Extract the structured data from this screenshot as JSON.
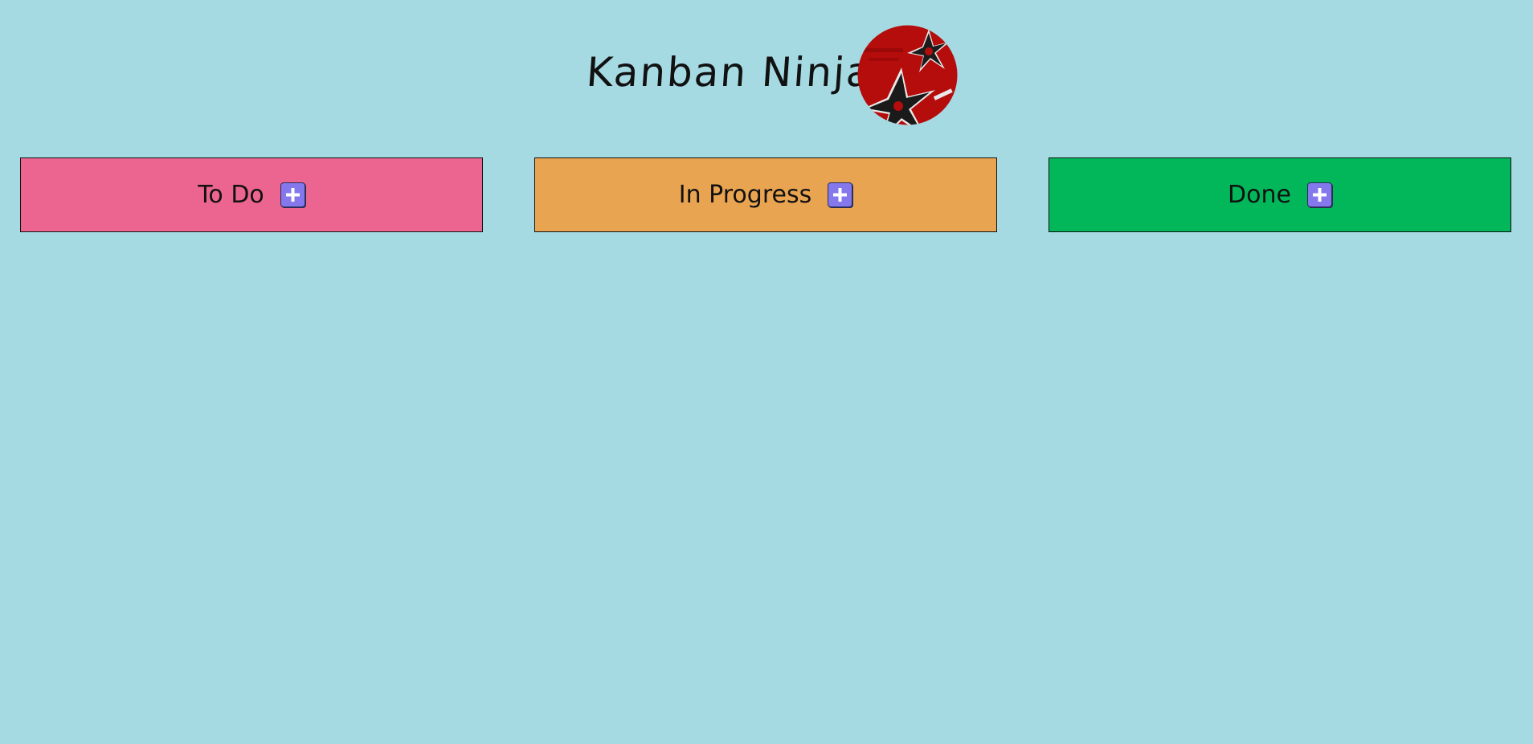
{
  "app": {
    "title": "Kanban Ninja",
    "logo_icon": "ninja-shuriken-logo-icon",
    "background_color": "#a6dae3"
  },
  "columns": [
    {
      "title": "To Do",
      "color": "#ec6590",
      "add_icon": "plus-icon"
    },
    {
      "title": "In Progress",
      "color": "#e9a451",
      "add_icon": "plus-icon"
    },
    {
      "title": "Done",
      "color": "#02b75a",
      "add_icon": "plus-icon"
    }
  ],
  "accent": {
    "add_button_color": "#8478ec"
  }
}
